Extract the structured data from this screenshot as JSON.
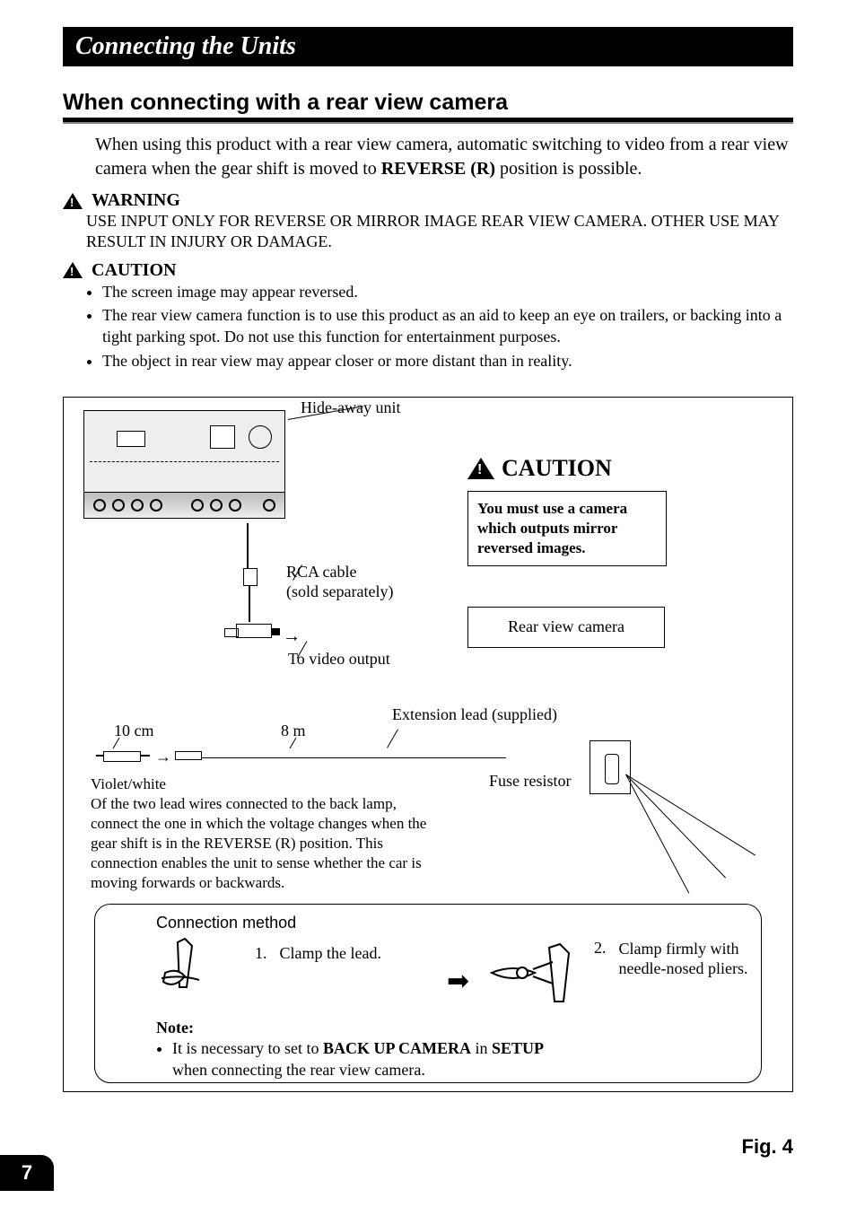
{
  "banner": "Connecting the Units",
  "sectionTitle": "When connecting with a rear view camera",
  "intro": {
    "pre": "When using this product with a rear view camera, automatic switching to video from a rear view camera when the gear shift is moved to ",
    "bold": "REVERSE (R)",
    "post": " position is possible."
  },
  "warning": {
    "label": "WARNING",
    "body": "USE INPUT ONLY FOR REVERSE OR MIRROR IMAGE REAR VIEW CAMERA. OTHER USE MAY RESULT IN INJURY OR DAMAGE."
  },
  "caution": {
    "label": "CAUTION",
    "items": [
      "The screen image may appear reversed.",
      "The rear view camera function is to use this product as an aid to keep an eye on trailers, or backing into a tight parking spot. Do not use this function for entertainment purposes.",
      "The object in rear view may appear closer or more distant than in reality."
    ]
  },
  "diagram": {
    "hideaway": "Hide-away unit",
    "rca_line1": "RCA cable",
    "rca_line2": "(sold separately)",
    "toVideo": "To video output",
    "rvc": "Rear view camera",
    "cautionBoxLabel": "CAUTION",
    "cautionBoxBody": "You must use a camera which outputs mirror reversed images.",
    "ext": "Extension lead (supplied)",
    "len10": "10 cm",
    "len8m": "8 m",
    "fuse": "Fuse resistor",
    "vw_title": "Violet/white",
    "vw_body": "Of the two lead wires connected to the back lamp, connect the one in which the voltage changes when the gear shift is in the REVERSE (R) position. This connection enables the unit to sense whether the car is moving forwards or backwards.",
    "method": {
      "title": "Connection method",
      "step1_num": "1.",
      "step1_txt": "Clamp the lead.",
      "step2_num": "2.",
      "step2_txt": "Clamp firmly with needle-nosed pliers.",
      "note_label": "Note:",
      "note_pre": "It is necessary to set to ",
      "note_b1": "BACK UP CAMERA",
      "note_mid": " in ",
      "note_b2": "SETUP",
      "note_post": "when connecting the rear view camera."
    }
  },
  "figLabel": "Fig. 4",
  "pageNumber": "7"
}
